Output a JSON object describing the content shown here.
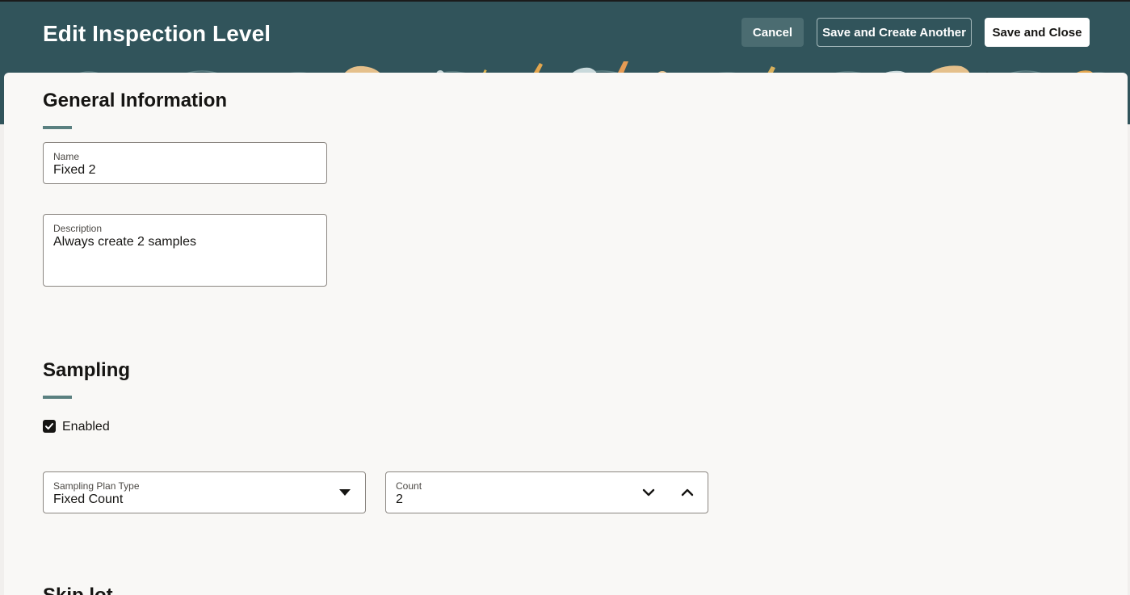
{
  "header": {
    "title": "Edit Inspection Level",
    "cancel_label": "Cancel",
    "save_create_label": "Save and Create Another",
    "save_close_label": "Save and Close"
  },
  "general": {
    "title": "General Information",
    "name": {
      "label": "Name",
      "value": "Fixed 2"
    },
    "description": {
      "label": "Description",
      "value": "Always create 2 samples"
    }
  },
  "sampling": {
    "title": "Sampling",
    "enabled_label": "Enabled",
    "enabled": true,
    "plan_type": {
      "label": "Sampling Plan Type",
      "value": "Fixed Count"
    },
    "count": {
      "label": "Count",
      "value": "2"
    }
  },
  "next_section": {
    "title": "Skip lot"
  },
  "icons": [
    "caret-down-icon",
    "chevron-down-icon",
    "chevron-up-icon",
    "check-icon"
  ],
  "colors": {
    "header_bg": "#31545b",
    "accent": "#5a8080",
    "panel_bg": "#f9f8f6"
  }
}
